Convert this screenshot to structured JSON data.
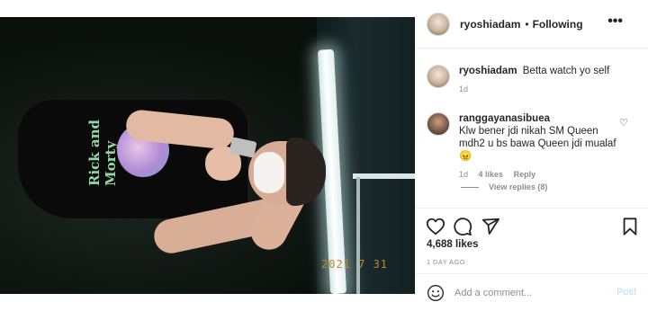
{
  "post": {
    "photo_stamp": "2021 7 31",
    "shirt_print": "Rick and Morty"
  },
  "header": {
    "username": "ryoshiadam",
    "separator": "•",
    "follow_status": "Following",
    "more_icon": "more-horizontal-icon"
  },
  "comments": [
    {
      "username": "ryoshiadam",
      "text": "Betta watch yo self",
      "time": "1d"
    },
    {
      "username": "ranggayanasibuea",
      "text": "Klw bener jdi nikah SM Queen mdh2 u bs bawa Queen jdi mualaf😠",
      "time": "1d",
      "likes": "4 likes",
      "reply_label": "Reply"
    }
  ],
  "view_replies": "View replies (8)",
  "actions": {
    "icons": [
      "heart-icon",
      "comment-icon",
      "share-icon",
      "bookmark-icon"
    ],
    "likes_count": "4,688 likes",
    "timestamp": "1 DAY AGO"
  },
  "add_comment": {
    "placeholder": "Add a comment...",
    "post_label": "Post",
    "post_color": "#b2dffc"
  }
}
